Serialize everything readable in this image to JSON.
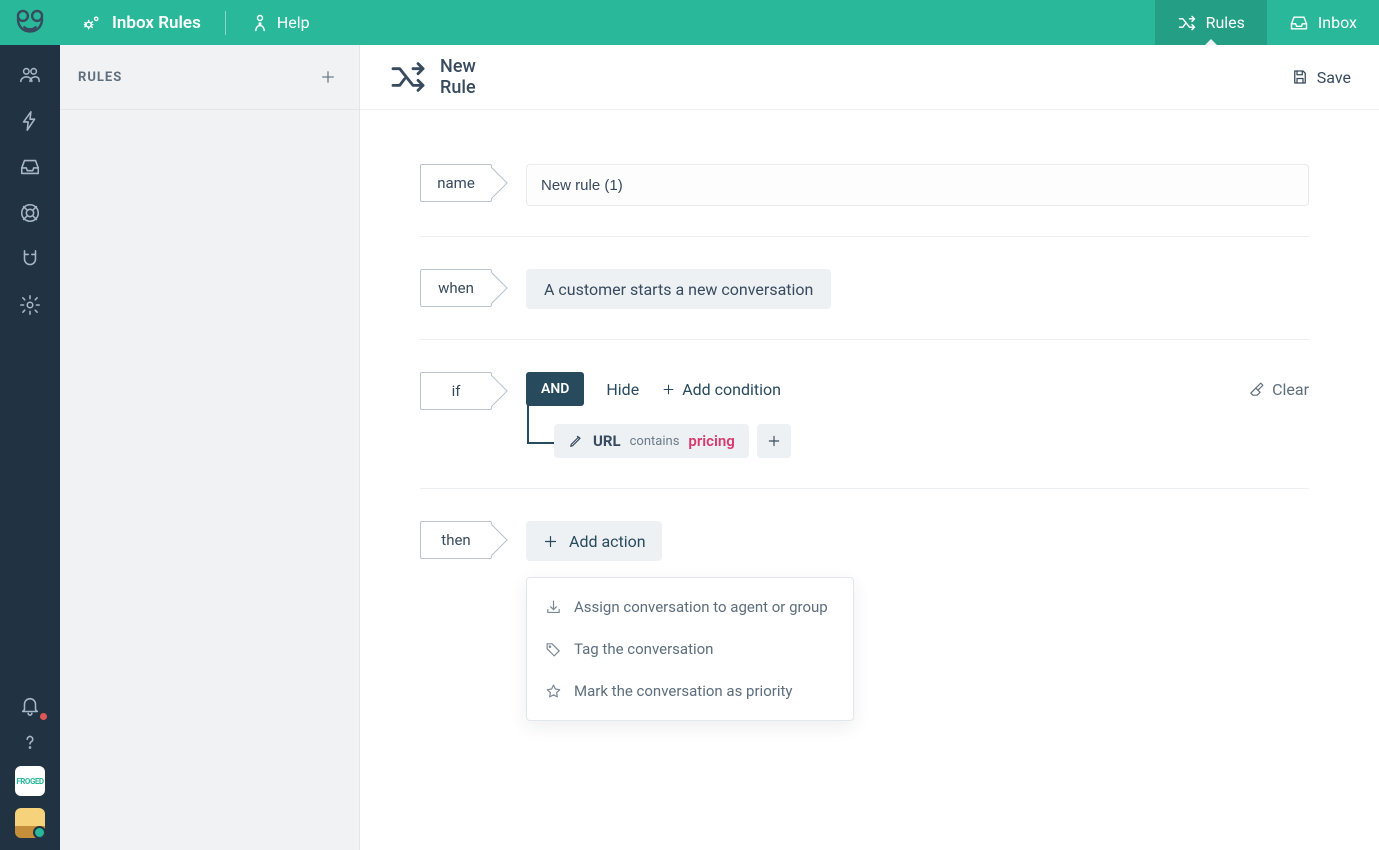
{
  "header": {
    "title": "Inbox Rules",
    "help": "Help",
    "tabs": {
      "rules": "Rules",
      "inbox": "Inbox"
    }
  },
  "sidebar": {
    "heading": "RULES"
  },
  "main": {
    "title": "New Rule",
    "save": "Save",
    "labels": {
      "name": "name",
      "when": "when",
      "if": "if",
      "then": "then"
    },
    "name_value": "New rule (1)",
    "when_value": "A customer starts a new conversation",
    "if": {
      "and": "AND",
      "hide": "Hide",
      "add_condition": "Add condition",
      "clear": "Clear",
      "condition": {
        "key": "URL",
        "op": "contains",
        "value": "pricing"
      }
    },
    "then": {
      "add_action": "Add action",
      "options": [
        "Assign conversation to agent or group",
        "Tag the conversation",
        "Mark the conversation as priority"
      ]
    }
  }
}
